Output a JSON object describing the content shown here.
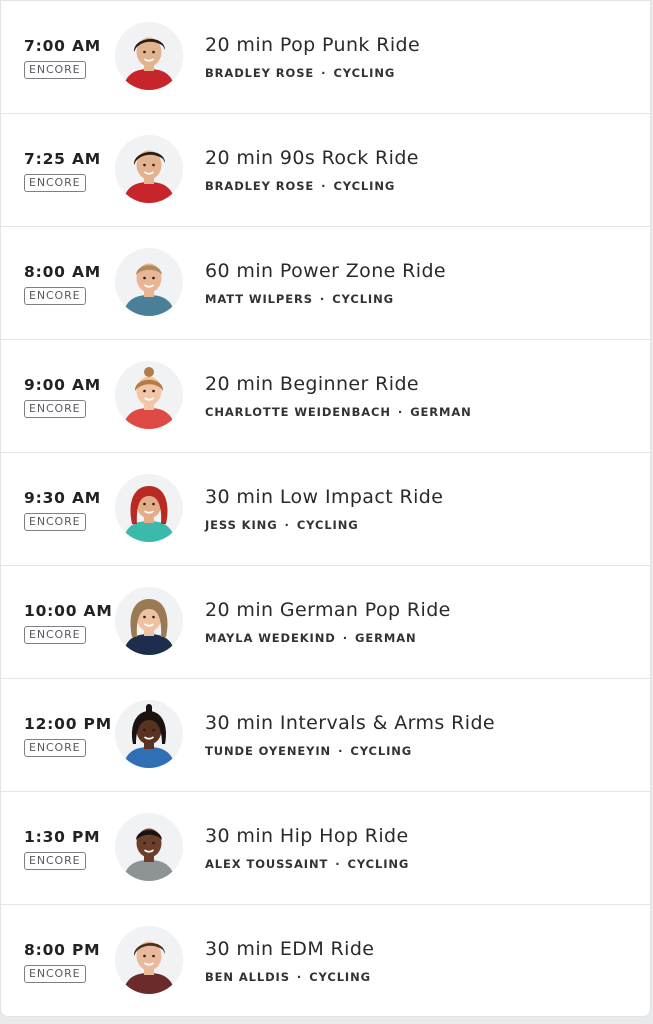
{
  "colors": {
    "background": "#ffffff",
    "divider": "#e4e5e7",
    "text_primary": "#2a2a2a",
    "badge_border": "#7c7f84"
  },
  "classes": [
    {
      "time": "7:00 AM",
      "badge": "ENCORE",
      "title": "20 min Pop Punk Ride",
      "instructor": "BRADLEY ROSE",
      "category": "CYCLING",
      "avatar": {
        "skin": "#e3b28f",
        "hair": "#2b1d16",
        "shirt": "#c8242b",
        "hair_style": "short"
      }
    },
    {
      "time": "7:25 AM",
      "badge": "ENCORE",
      "title": "20 min 90s Rock Ride",
      "instructor": "BRADLEY ROSE",
      "category": "CYCLING",
      "avatar": {
        "skin": "#e3b28f",
        "hair": "#2b1d16",
        "shirt": "#c8242b",
        "hair_style": "short"
      }
    },
    {
      "time": "8:00 AM",
      "badge": "ENCORE",
      "title": "60 min Power Zone Ride",
      "instructor": "MATT WILPERS",
      "category": "CYCLING",
      "avatar": {
        "skin": "#e8b597",
        "hair": "#b08a5c",
        "shirt": "#4a7f98",
        "hair_style": "buzz"
      }
    },
    {
      "time": "9:00 AM",
      "badge": "ENCORE",
      "title": "20 min Beginner Ride",
      "instructor": "CHARLOTTE WEIDENBACH",
      "category": "GERMAN",
      "avatar": {
        "skin": "#f1c6a6",
        "hair": "#b57a45",
        "shirt": "#e04a45",
        "hair_style": "bun"
      }
    },
    {
      "time": "9:30 AM",
      "badge": "ENCORE",
      "title": "30 min Low Impact Ride",
      "instructor": "JESS KING",
      "category": "CYCLING",
      "avatar": {
        "skin": "#e4ad8a",
        "hair": "#b92a22",
        "shirt": "#3bb9aa",
        "hair_style": "long"
      }
    },
    {
      "time": "10:00 AM",
      "badge": "ENCORE",
      "title": "20 min German Pop Ride",
      "instructor": "MAYLA WEDEKIND",
      "category": "GERMAN",
      "avatar": {
        "skin": "#eec2a0",
        "hair": "#9a7a52",
        "shirt": "#1f2d4d",
        "hair_style": "long"
      }
    },
    {
      "time": "12:00 PM",
      "badge": "ENCORE",
      "title": "30 min Intervals & Arms Ride",
      "instructor": "TUNDE OYENEYIN",
      "category": "CYCLING",
      "avatar": {
        "skin": "#5a3320",
        "hair": "#1a1210",
        "shirt": "#2f6fb5",
        "hair_style": "braids"
      }
    },
    {
      "time": "1:30 PM",
      "badge": "ENCORE",
      "title": "30 min Hip Hop Ride",
      "instructor": "ALEX TOUSSAINT",
      "category": "CYCLING",
      "avatar": {
        "skin": "#6b3f29",
        "hair": "#1a1210",
        "shirt": "#8e9495",
        "hair_style": "buzz"
      }
    },
    {
      "time": "8:00 PM",
      "badge": "ENCORE",
      "title": "30 min EDM Ride",
      "instructor": "BEN ALLDIS",
      "category": "CYCLING",
      "avatar": {
        "skin": "#e9b99b",
        "hair": "#4a3222",
        "shirt": "#6b2b2a",
        "hair_style": "short"
      }
    }
  ]
}
